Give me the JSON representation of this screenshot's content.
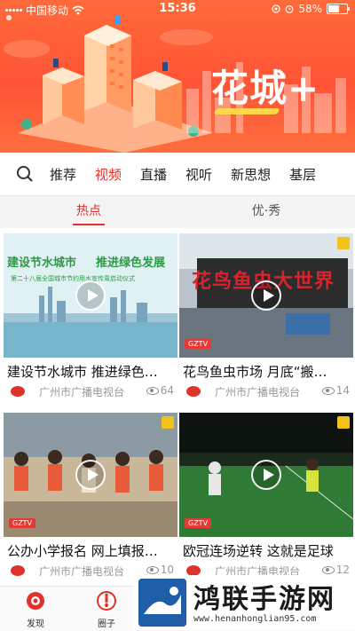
{
  "status_bar": {
    "carrier": "中国移动",
    "time": "15:36",
    "battery": "58%",
    "battery_level": 0.58,
    "icons": [
      "wifi-icon",
      "location-icon",
      "alarm-icon",
      "battery-icon"
    ]
  },
  "header": {
    "brand": "花城+"
  },
  "nav": {
    "search_icon": "search-icon",
    "items": [
      "推荐",
      "视频",
      "直播",
      "视听",
      "新思想",
      "基层"
    ],
    "active_index": 1
  },
  "subtabs": {
    "items": [
      "热点",
      "优·秀"
    ],
    "active_index": 0
  },
  "videos": [
    {
      "title": "建设节水城市 推进绿色…",
      "source": "广州市广播电视台",
      "views": "64",
      "thumb_text_1": "建设节水城市",
      "thumb_text_2": "推进绿色发展",
      "thumb_caption": "第二十八届全国城市节约用水宣传周启动仪式"
    },
    {
      "title": "花鸟鱼虫市场 月底“搬…",
      "source": "广州市广播电视台",
      "views": "14",
      "thumb_text_1": "花鸟鱼虫大世界"
    },
    {
      "title": "公办小学报名 网上填报…",
      "source": "广州市广播电视台",
      "views": "10"
    },
    {
      "title": "欧冠连场逆转 这就是足球",
      "source": "广州市广播电视台",
      "views": "12"
    }
  ],
  "tabbar": {
    "items": [
      {
        "label": "发现",
        "icon": "discover-icon"
      },
      {
        "label": "圈子",
        "icon": "circle-icon"
      }
    ]
  },
  "watermark": {
    "name": "鸿联手游网",
    "url": "www.henanhonglian95.com"
  },
  "colors": {
    "accent": "#e0322c",
    "banner": "#ff5436",
    "brand_highlight": "#ffd84a"
  }
}
